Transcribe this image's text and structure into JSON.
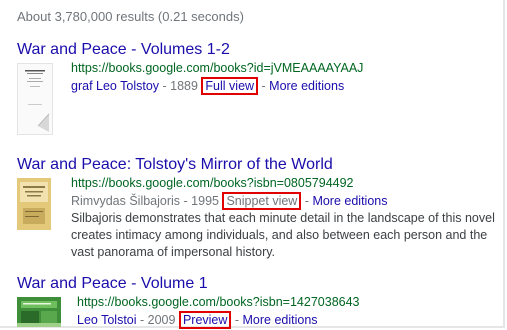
{
  "stats": "About 3,780,000 results (0.21 seconds)",
  "results": [
    {
      "title": "War and Peace - Volumes 1-2",
      "url": "https://books.google.com/books?id=jVMEAAAAYAAJ",
      "author": "graf Leo Tolstoy",
      "year_sep": " - 1889 ",
      "view_label": "Full view",
      "dash": " - ",
      "editions_label": "More editions",
      "thumb_icon": "book-cover-plain"
    },
    {
      "title": "War and Peace: Tolstoy's Mirror of the World",
      "url": "https://books.google.com/books?isbn=0805794492",
      "author": "Rimvydas Šilbajoris",
      "year_sep": " - 1995 ",
      "view_label": "Snippet view",
      "dash": " - ",
      "editions_label": "More editions",
      "snippet": "Silbajoris demonstrates that each minute detail in the landscape of this novel creates intimacy among individuals, and also between each person and the vast panorama of impersonal history.",
      "thumb_icon": "book-cover-yellow"
    },
    {
      "title": "War and Peace - Volume 1",
      "url": "https://books.google.com/books?isbn=1427038643",
      "author": "Leo Tolstoi",
      "year_sep": " - 2009 ",
      "view_label": "Preview",
      "dash": " - ",
      "editions_label": "More editions",
      "thumb_icon": "book-cover-green"
    }
  ],
  "colors": {
    "link": "#1a0dab",
    "url": "#006621",
    "meta": "#70757a",
    "highlight_box": "#e00000"
  }
}
